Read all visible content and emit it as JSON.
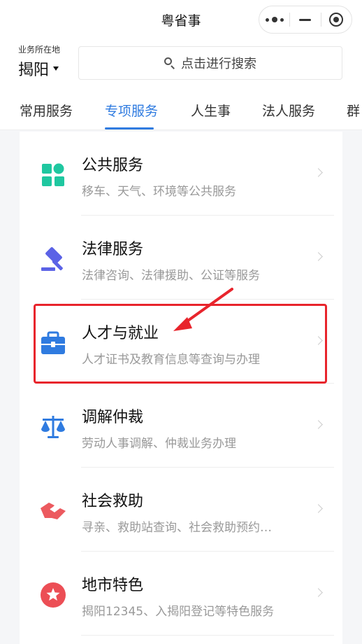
{
  "header": {
    "title": "粤省事"
  },
  "location": {
    "label": "业务所在地",
    "city": "揭阳"
  },
  "search": {
    "placeholder": "点击进行搜索"
  },
  "tabs": [
    {
      "label": "常用服务",
      "active": false
    },
    {
      "label": "专项服务",
      "active": true
    },
    {
      "label": "人生事",
      "active": false
    },
    {
      "label": "法人服务",
      "active": false
    },
    {
      "label": "群",
      "active": false
    }
  ],
  "services": [
    {
      "title": "公共服务",
      "desc": "移车、天气、环境等公共服务",
      "icon": "grid-icon",
      "color": "#1fc7a0"
    },
    {
      "title": "法律服务",
      "desc": "法律咨询、法律援助、公证等服务",
      "icon": "gavel-icon",
      "color": "#5b62e6"
    },
    {
      "title": "人才与就业",
      "desc": "人才证书及教育信息等查询与办理",
      "icon": "briefcase-icon",
      "color": "#2f7be0"
    },
    {
      "title": "调解仲裁",
      "desc": "劳动人事调解、仲裁业务办理",
      "icon": "scale-icon",
      "color": "#2f7be0"
    },
    {
      "title": "社会救助",
      "desc": "寻亲、救助站查询、社会救助预约…",
      "icon": "handshake-icon",
      "color": "#ec5a5f"
    },
    {
      "title": "地市特色",
      "desc": "揭阳12345、入揭阳登记等特色服务",
      "icon": "star-icon",
      "color": "#ec4e55"
    }
  ],
  "colors": {
    "accent": "#2f7be0",
    "highlight": "#e8242c"
  }
}
